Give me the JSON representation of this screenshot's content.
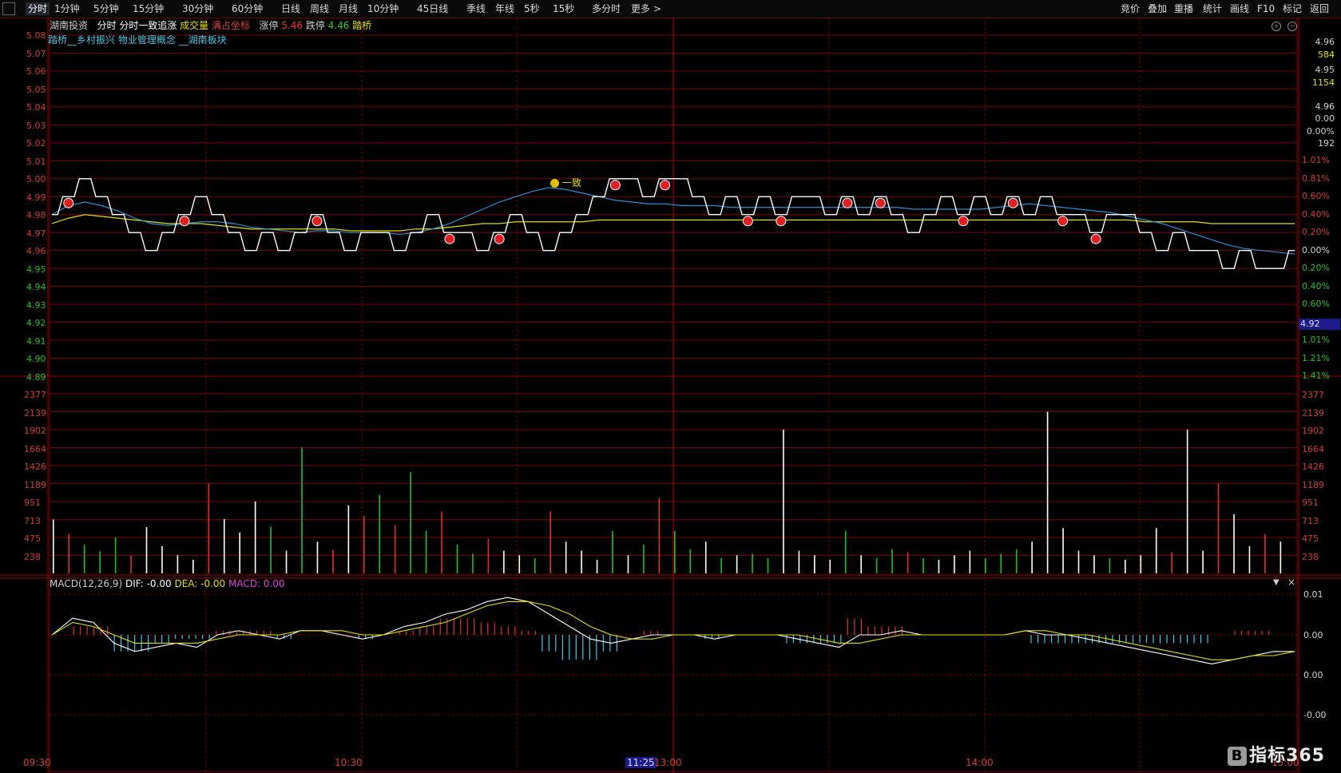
{
  "toolbar": {
    "periods": [
      "分时",
      "1分钟",
      "5分钟",
      "15分钟",
      "30分钟",
      "60分钟",
      "日线",
      "周线",
      "月线",
      "10分钟",
      "45日线",
      "季线",
      "年线",
      "5秒",
      "15秒",
      "多分时",
      "更多 >"
    ],
    "active_period": "分时",
    "right_tools": [
      "竞价",
      "叠加",
      "重播",
      "统计",
      "画线",
      "F10",
      "标记",
      "返回"
    ]
  },
  "header": {
    "stock_name": "湖南投资",
    "chart_kind": "分时",
    "indicator_name": "分时一致追涨",
    "volume_label": "成交量",
    "coord_label": "满占坐标",
    "limit_up_label": "涨停",
    "limit_up_value": "5.46",
    "limit_down_label": "跌停",
    "limit_down_value": "4.46",
    "concept_label": "踏桥",
    "concept_line": "踏桥__乡村振兴 物业管理概念 __湖南板块",
    "signal_label": "一致"
  },
  "price_axis_left": [
    "5.08",
    "5.07",
    "5.06",
    "5.05",
    "5.04",
    "5.03",
    "5.02",
    "5.01",
    "5.00",
    "4.99",
    "4.98",
    "4.97",
    "4.96",
    "4.95",
    "4.94",
    "4.93",
    "4.92",
    "4.91",
    "4.90",
    "4.89"
  ],
  "percent_axis_right": [
    "1.01%",
    "0.81%",
    "0.60%",
    "0.40%",
    "0.20%",
    "0.00%",
    "0.20%",
    "0.40%",
    "0.60%",
    "0.81%",
    "1.01%",
    "1.21%",
    "1.41%"
  ],
  "volume_axis": [
    "2377",
    "2139",
    "1902",
    "1664",
    "1426",
    "1189",
    "951",
    "713",
    "475",
    "238"
  ],
  "quote_panel": [
    "4.96",
    "584",
    "4.95",
    "1154",
    "4.96",
    "0.00",
    "0.00%",
    "192"
  ],
  "current_price_label": "4.92",
  "macd_header": {
    "name": "MACD(12,26,9)",
    "dif": "DIF: -0.00",
    "dea": "DEA: -0.00",
    "macd": "MACD: 0.00"
  },
  "macd_axis": [
    "0.01",
    "0.00",
    "0.00",
    "-0.00"
  ],
  "time_axis": {
    "t0930": "09:30",
    "t1030": "10:30",
    "t1125": "11:25",
    "t1300": "13:00",
    "t1400": "14:00",
    "t1500": "15:00"
  },
  "watermark": "指标365",
  "colors": {
    "grid": "#7a0000",
    "price_line": "#ffffff",
    "avg_line": "#e0e000",
    "ma_line": "#2a8fd6",
    "buy_marker": "#e02020",
    "volume_up": "#e03030",
    "volume_down": "#20c020",
    "macd_pos": "#e03030",
    "macd_neg": "#40c8e8"
  },
  "chart_data": {
    "type": "line",
    "title": "湖南投资 分时",
    "ylim": [
      4.89,
      5.08
    ],
    "price": [
      4.98,
      4.99,
      5.0,
      4.99,
      4.98,
      4.97,
      4.96,
      4.97,
      4.98,
      4.99,
      4.98,
      4.97,
      4.96,
      4.97,
      4.96,
      4.97,
      4.98,
      4.97,
      4.96,
      4.97,
      4.97,
      4.96,
      4.97,
      4.98,
      4.97,
      4.97,
      4.96,
      4.97,
      4.98,
      4.97,
      4.96,
      4.97,
      4.98,
      4.99,
      5.0,
      5.0,
      4.99,
      5.0,
      5.0,
      4.99,
      4.98,
      4.99,
      4.98,
      4.99,
      4.98,
      4.99,
      4.99,
      4.98,
      4.99,
      4.98,
      4.99,
      4.98,
      4.97,
      4.98,
      4.99,
      4.98,
      4.99,
      4.98,
      4.99,
      4.98,
      4.99,
      4.98,
      4.98,
      4.97,
      4.98,
      4.98,
      4.97,
      4.96,
      4.97,
      4.96,
      4.96,
      4.95,
      4.96,
      4.95,
      4.95,
      4.96
    ],
    "avg": [
      4.975,
      4.978,
      4.98,
      4.979,
      4.978,
      4.977,
      4.976,
      4.975,
      4.975,
      4.975,
      4.974,
      4.973,
      4.972,
      4.972,
      4.972,
      4.972,
      4.972,
      4.972,
      4.971,
      4.971,
      4.971,
      4.971,
      4.972,
      4.972,
      4.973,
      4.974,
      4.975,
      4.975,
      4.976,
      4.976,
      4.976,
      4.976,
      4.976,
      4.977,
      4.977,
      4.977,
      4.977,
      4.977,
      4.977,
      4.977,
      4.977,
      4.977,
      4.977,
      4.977,
      4.977,
      4.977,
      4.977,
      4.977,
      4.977,
      4.977,
      4.977,
      4.977,
      4.977,
      4.977,
      4.977,
      4.977,
      4.977,
      4.977,
      4.977,
      4.977,
      4.977,
      4.977,
      4.977,
      4.977,
      4.977,
      4.977,
      4.976,
      4.976,
      4.976,
      4.976,
      4.975,
      4.975,
      4.975,
      4.975,
      4.975,
      4.975
    ],
    "ma": [
      4.98,
      4.985,
      4.987,
      4.985,
      4.982,
      4.978,
      4.975,
      4.974,
      4.975,
      4.976,
      4.976,
      4.975,
      4.973,
      4.972,
      4.971,
      4.97,
      4.971,
      4.971,
      4.97,
      4.97,
      4.97,
      4.969,
      4.97,
      4.972,
      4.975,
      4.979,
      4.983,
      4.987,
      4.99,
      4.993,
      4.995,
      4.994,
      4.992,
      4.99,
      4.988,
      4.987,
      4.986,
      4.986,
      4.985,
      4.985,
      4.985,
      4.984,
      4.984,
      4.984,
      4.984,
      4.984,
      4.984,
      4.984,
      4.984,
      4.984,
      4.984,
      4.984,
      4.983,
      4.983,
      4.983,
      4.983,
      4.983,
      4.984,
      4.985,
      4.986,
      4.985,
      4.984,
      4.983,
      4.982,
      4.981,
      4.979,
      4.977,
      4.975,
      4.972,
      4.969,
      4.966,
      4.963,
      4.961,
      4.96,
      4.959,
      4.958
    ],
    "volume": [
      713,
      520,
      380,
      290,
      476,
      238,
      612,
      360,
      240,
      180,
      1189,
      720,
      540,
      951,
      620,
      300,
      1664,
      420,
      310,
      900,
      760,
      1040,
      640,
      1340,
      560,
      820,
      380,
      260,
      460,
      300,
      240,
      200,
      820,
      420,
      300,
      180,
      560,
      240,
      380,
      1000,
      560,
      320,
      420,
      200,
      240,
      260,
      200,
      1902,
      300,
      240,
      180,
      560,
      240,
      200,
      320,
      280,
      200,
      180,
      240,
      300,
      200,
      260,
      320,
      420,
      2139,
      600,
      300,
      240,
      200,
      180,
      240,
      600,
      280,
      1902,
      300,
      1189,
      780,
      360,
      520,
      420
    ],
    "macd_dif": [
      0.0,
      0.004,
      0.003,
      -0.002,
      -0.004,
      -0.003,
      -0.002,
      -0.003,
      0.0,
      0.001,
      0.0,
      -0.001,
      0.001,
      0.001,
      0.0,
      -0.001,
      0.0,
      0.002,
      0.003,
      0.005,
      0.006,
      0.008,
      0.009,
      0.008,
      0.005,
      0.002,
      -0.001,
      -0.002,
      -0.001,
      0.0,
      0.0,
      0.0,
      -0.001,
      0.0,
      0.0,
      0.0,
      -0.001,
      -0.002,
      -0.003,
      0.0,
      0.0,
      0.001,
      0.0,
      0.0,
      0.0,
      0.0,
      0.0,
      0.001,
      0.0,
      0.0,
      -0.001,
      -0.002,
      -0.003,
      -0.004,
      -0.005,
      -0.006,
      -0.007,
      -0.006,
      -0.005,
      -0.004,
      -0.004
    ],
    "macd_dea": [
      0.0,
      0.003,
      0.002,
      0.0,
      -0.002,
      -0.002,
      -0.002,
      -0.002,
      -0.001,
      0.0,
      0.0,
      0.0,
      0.001,
      0.001,
      0.001,
      0.0,
      0.0,
      0.001,
      0.002,
      0.003,
      0.005,
      0.007,
      0.008,
      0.008,
      0.007,
      0.005,
      0.002,
      0.0,
      -0.001,
      -0.001,
      0.0,
      0.0,
      0.0,
      0.0,
      0.0,
      0.0,
      0.0,
      -0.001,
      -0.002,
      -0.002,
      -0.001,
      0.0,
      0.0,
      0.0,
      0.0,
      0.0,
      0.0,
      0.001,
      0.001,
      0.0,
      0.0,
      -0.001,
      -0.002,
      -0.003,
      -0.004,
      -0.005,
      -0.006,
      -0.006,
      -0.005,
      -0.005,
      -0.004
    ],
    "macd_hist": [
      0.0,
      0.002,
      0.002,
      -0.004,
      -0.004,
      -0.002,
      -0.001,
      -0.001,
      0.001,
      0.001,
      0.001,
      -0.001,
      0.0,
      0.0,
      0.0,
      -0.001,
      0.0,
      0.001,
      0.002,
      0.004,
      0.004,
      0.003,
      0.002,
      0.001,
      -0.004,
      -0.006,
      -0.006,
      -0.004,
      0.0,
      0.001,
      0.0,
      0.0,
      -0.001,
      0.0,
      0.0,
      0.0,
      -0.002,
      -0.002,
      -0.002,
      0.004,
      0.002,
      0.002,
      0.0,
      0.0,
      0.0,
      0.0,
      0.0,
      0.0,
      -0.002,
      -0.002,
      -0.002,
      -0.002,
      -0.002,
      -0.002,
      -0.002,
      -0.002,
      -0.002,
      0.0,
      0.001,
      0.001,
      0.0
    ]
  }
}
